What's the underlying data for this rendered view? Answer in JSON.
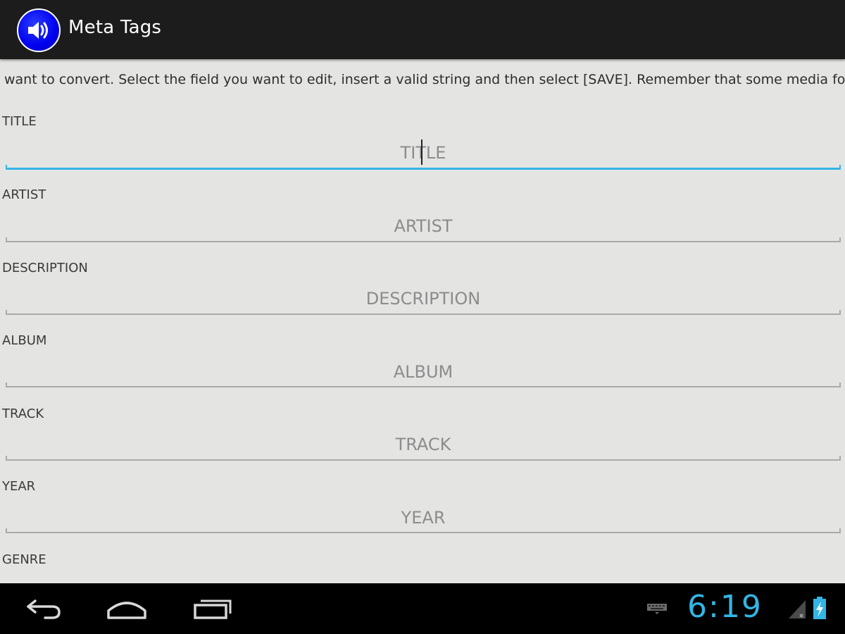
{
  "action_bar": {
    "title": "Meta Tags",
    "icon": "speaker-icon"
  },
  "instruction_text": "want to convert. Select the field you want to edit, insert a valid string and then select [SAVE]. Remember that some media formats s",
  "fields": [
    {
      "label": "TITLE",
      "placeholder": "TITLE",
      "value": ""
    },
    {
      "label": "ARTIST",
      "placeholder": "ARTIST",
      "value": ""
    },
    {
      "label": "DESCRIPTION",
      "placeholder": "DESCRIPTION",
      "value": ""
    },
    {
      "label": "ALBUM",
      "placeholder": "ALBUM",
      "value": ""
    },
    {
      "label": "TRACK",
      "placeholder": "TRACK",
      "value": ""
    },
    {
      "label": "YEAR",
      "placeholder": "YEAR",
      "value": ""
    },
    {
      "label": "GENRE",
      "placeholder": "",
      "value": ""
    }
  ],
  "focused_field": "TITLE",
  "navigation_bar": {
    "buttons": [
      "back-icon",
      "home-icon",
      "recent-apps-icon"
    ]
  },
  "status_bar": {
    "time": "6:19",
    "icons": [
      "keyboard-icon",
      "signal-icon",
      "battery-charging-icon"
    ]
  },
  "colors": {
    "accent": "#33b5e5",
    "app_icon": "#0000ee",
    "action_bar": "#1c1c1c",
    "background": "#e4e5e3"
  }
}
